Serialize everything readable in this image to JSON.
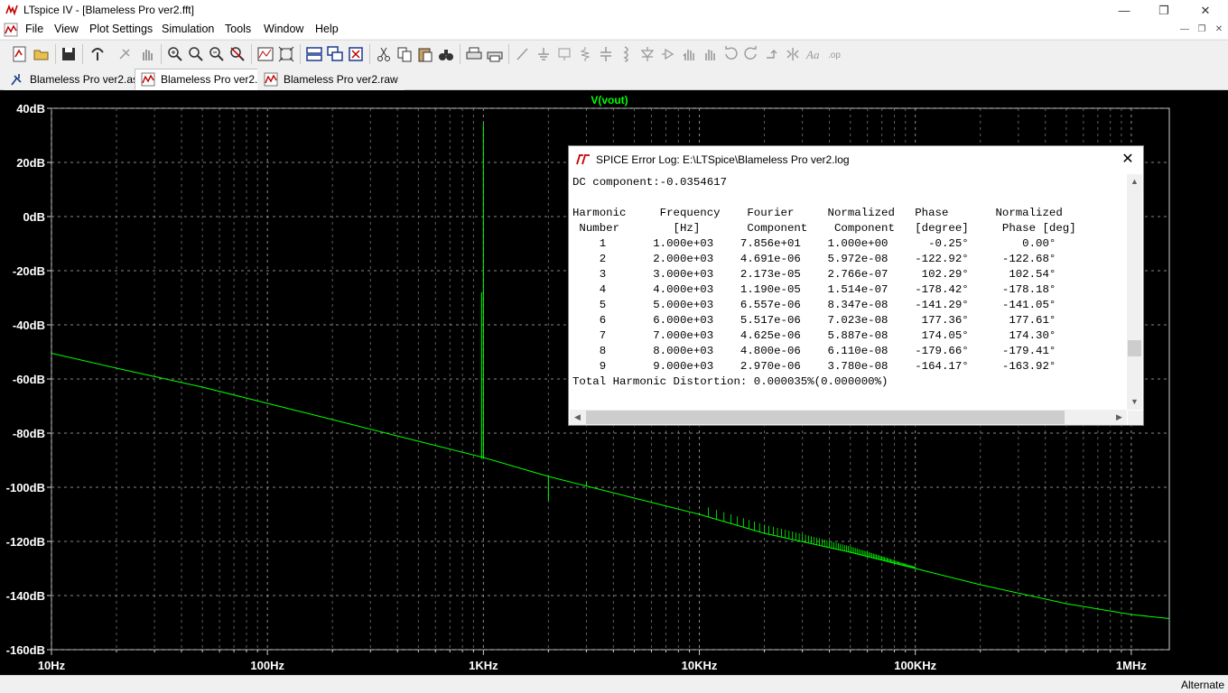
{
  "window": {
    "title": "LTspice IV - [Blameless Pro ver2.fft]",
    "minimize_glyph": "—",
    "maximize_glyph": "❐",
    "close_glyph": "✕"
  },
  "menu": {
    "items": [
      "File",
      "View",
      "Plot Settings",
      "Simulation",
      "Tools",
      "Window",
      "Help"
    ]
  },
  "toolbar": {
    "icons": [
      "new-schematic-icon",
      "open-icon",
      "save-icon",
      "control-panel-icon",
      "run-icon",
      "halt-icon",
      "zoom-in-icon",
      "zoom-out-icon",
      "zoom-pan-icon",
      "zoom-cancel-icon",
      "autorange-icon",
      "zoom-full-icon",
      "tile-horizontal-icon",
      "cascade-icon",
      "close-all-icon",
      "cut-icon",
      "copy-icon",
      "paste-icon",
      "find-icon",
      "print-setup-icon",
      "print-icon",
      "wire-icon",
      "ground-icon",
      "label-icon",
      "resistor-icon",
      "capacitor-icon",
      "inductor-icon",
      "diode-icon",
      "component-icon",
      "move-icon",
      "drag-icon",
      "undo-icon",
      "redo-icon",
      "rotate-icon",
      "mirror-icon",
      "text-icon",
      "spice-directive-icon"
    ]
  },
  "tabs": [
    {
      "label": "Blameless Pro ver2.asc",
      "icon": "schematic-icon",
      "active": false
    },
    {
      "label": "Blameless Pro ver2.fft",
      "icon": "waveform-icon",
      "active": true
    },
    {
      "label": "Blameless Pro ver2.raw",
      "icon": "waveform-icon",
      "active": false
    }
  ],
  "chart_data": {
    "type": "line",
    "title": "V(vout)",
    "xscale": "log",
    "xlim": [
      10,
      1500000
    ],
    "ylim": [
      -160,
      40
    ],
    "grid": true,
    "x_tick_labels": [
      "10Hz",
      "100Hz",
      "1KHz",
      "10KHz",
      "100KHz",
      "1MHz"
    ],
    "x_ticks": [
      10,
      100,
      1000,
      10000,
      100000,
      1000000
    ],
    "y_tick_labels": [
      "40dB",
      "20dB",
      "0dB",
      "-20dB",
      "-40dB",
      "-60dB",
      "-80dB",
      "-100dB",
      "-120dB",
      "-140dB",
      "-160dB"
    ],
    "y_ticks": [
      40,
      20,
      0,
      -20,
      -40,
      -60,
      -80,
      -100,
      -120,
      -140,
      -160
    ],
    "trace_color": "#00ff00",
    "grid_color": "#a0a0a0",
    "series": [
      {
        "name": "V(vout)",
        "x": [
          10,
          20,
          50,
          100,
          200,
          500,
          1000,
          2000,
          5000,
          10000,
          20000,
          50000,
          100000,
          200000,
          500000,
          1000000,
          1500000
        ],
        "y": [
          -50.5,
          -56,
          -63,
          -69,
          -75,
          -83,
          -89,
          -96,
          -104,
          -110,
          -117,
          -124,
          -130,
          -136,
          -143,
          -147,
          -148.5
        ]
      }
    ],
    "spikes": [
      {
        "x": 1000,
        "y": 34.5,
        "base": -89.5
      },
      {
        "x": 2000,
        "y": -105,
        "base": -96
      },
      {
        "x": 3000,
        "y": -98,
        "base": -99.5
      }
    ]
  },
  "error_log": {
    "title": "SPICE Error Log: E:\\LTSpice\\Blameless Pro ver2.log",
    "close_glyph": "✕",
    "lines": [
      "DC component:-0.0354617",
      "",
      "Harmonic     Frequency    Fourier     Normalized   Phase       Normalized",
      " Number        [Hz]       Component    Component   [degree]     Phase [deg]",
      "    1       1.000e+03    7.856e+01    1.000e+00      -0.25°        0.00°",
      "    2       2.000e+03    4.691e-06    5.972e-08    -122.92°     -122.68°",
      "    3       3.000e+03    2.173e-05    2.766e-07     102.29°      102.54°",
      "    4       4.000e+03    1.190e-05    1.514e-07    -178.42°     -178.18°",
      "    5       5.000e+03    6.557e-06    8.347e-08    -141.29°     -141.05°",
      "    6       6.000e+03    5.517e-06    7.023e-08     177.36°      177.61°",
      "    7       7.000e+03    4.625e-06    5.887e-08     174.05°      174.30°",
      "    8       8.000e+03    4.800e-06    6.110e-08    -179.66°     -179.41°",
      "    9       9.000e+03    2.970e-06    3.780e-08    -164.17°     -163.92°",
      "Total Harmonic Distortion: 0.000035%(0.000000%)"
    ]
  },
  "status": {
    "text": "Alternate"
  }
}
